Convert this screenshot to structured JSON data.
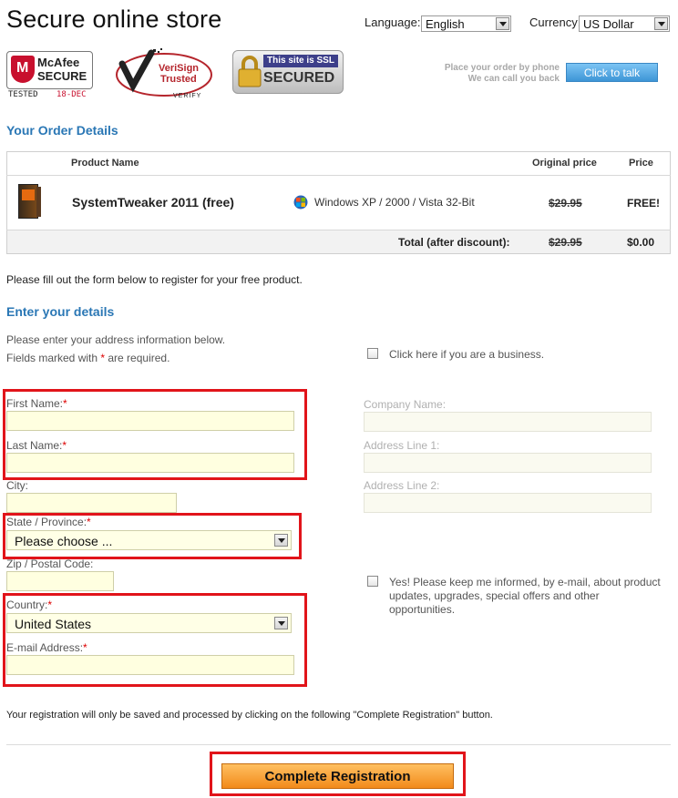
{
  "header": {
    "title": "Secure online store",
    "language_label": "Language:",
    "language_value": "English",
    "currency_label": "Currency:",
    "currency_value": "US Dollar"
  },
  "badges": {
    "mcafee": {
      "line1": "McAfee",
      "line2": "SECURE",
      "tested": "TESTED",
      "date": "18-DEC"
    },
    "verisign": {
      "line1": "VeriSign",
      "line2": "Trusted",
      "verify": "VERIFY"
    },
    "ssl": {
      "line1": "This site is SSL",
      "line2": "SECURED"
    }
  },
  "phone": {
    "line1": "Place your order by phone",
    "line2": "We can call you back",
    "button": "Click to talk"
  },
  "order": {
    "heading": "Your Order Details",
    "col_product": "Product Name",
    "col_original": "Original price",
    "col_price": "Price",
    "product_name": "SystemTweaker 2011 (free)",
    "platform": "Windows XP / 2000 / Vista 32-Bit",
    "original_price": "$29.95",
    "price": "FREE!",
    "total_label": "Total (after discount):",
    "total_original": "$29.95",
    "total_price": "$0.00"
  },
  "form": {
    "intro": "Please fill out the form below to register for your free product.",
    "heading": "Enter your details",
    "hint1": "Please enter your address information below.",
    "hint2_pre": "Fields marked with ",
    "hint2_star": "*",
    "hint2_post": " are required.",
    "business_check": "Click here if you are a business.",
    "first_name": "First Name:",
    "last_name": "Last Name:",
    "city": "City:",
    "state": "State / Province:",
    "state_value": "Please choose ...",
    "zip": "Zip / Postal Code:",
    "country": "Country:",
    "country_value": "United States",
    "email": "E-mail Address:",
    "star": "*",
    "company": "Company Name:",
    "address1": "Address Line 1:",
    "address2": "Address Line 2:",
    "newsletter": "Yes! Please keep me informed, by e-mail, about product updates, upgrades, special offers and other opportunities.",
    "notice": "Your registration will only be saved and processed by clicking on the following \"Complete Registration\" button.",
    "submit": "Complete Registration"
  },
  "colors": {
    "accent_blue": "#2a77b5",
    "highlight_red": "#e1141a",
    "cta_orange": "#f28a1a",
    "field_yellow": "#ffffe0"
  }
}
